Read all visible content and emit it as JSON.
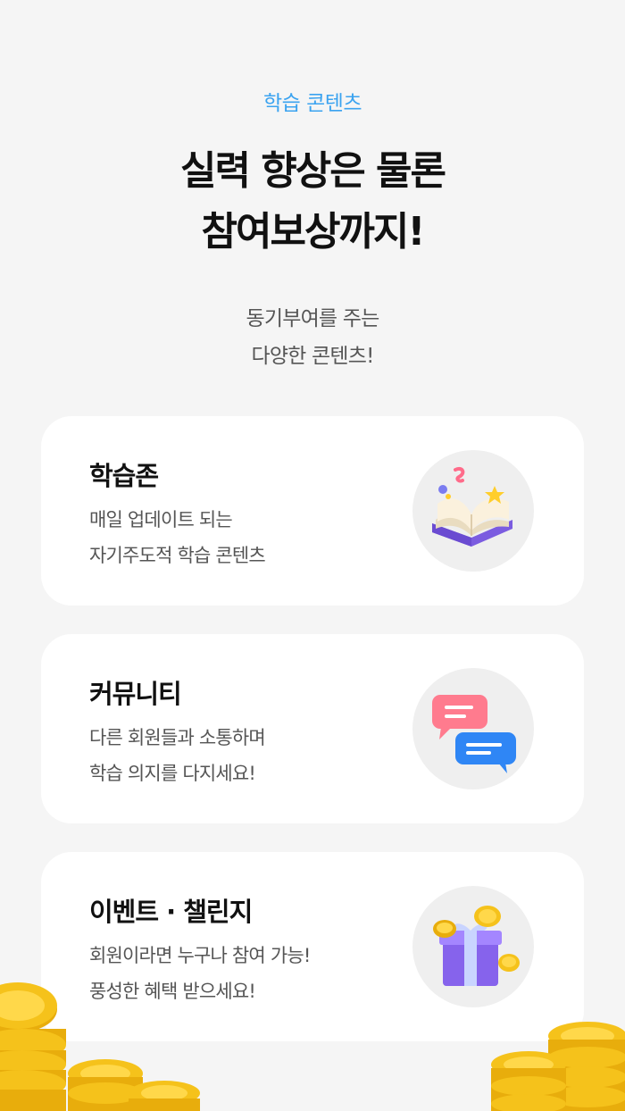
{
  "header": {
    "eyebrow": "학습 콘텐츠",
    "headline_line1": "실력 향상은 물론",
    "headline_line2": "참여보상까지!",
    "sub_line1": "동기부여를 주는",
    "sub_line2": "다양한 콘텐츠!"
  },
  "cards": [
    {
      "title": "학습존",
      "desc_line1": "매일 업데이트 되는",
      "desc_line2": "자기주도적 학습 콘텐츠",
      "icon": "open-book-icon"
    },
    {
      "title": "커뮤니티",
      "desc_line1": "다른 회원들과 소통하며",
      "desc_line2": "학습 의지를 다지세요!",
      "icon": "chat-bubbles-icon"
    },
    {
      "title": "이벤트 · 챌린지",
      "desc_line1": "회원이라면 누구나 참여 가능!",
      "desc_line2": "풍성한 혜택 받으세요!",
      "icon": "gift-box-icon"
    }
  ],
  "colors": {
    "accent": "#3ba3f0",
    "background": "#f5f5f5",
    "card": "#ffffff",
    "coin": "#f5c21b"
  },
  "decorations": [
    "coin-stack-icon"
  ]
}
